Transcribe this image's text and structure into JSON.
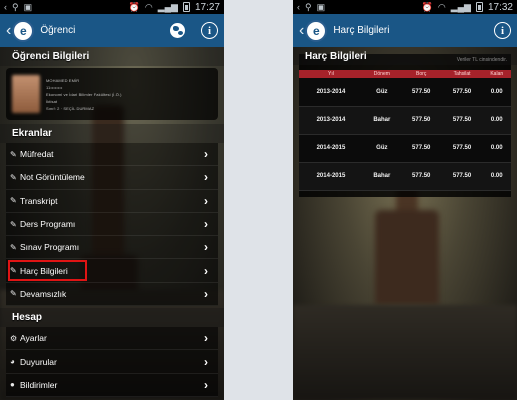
{
  "left_screen": {
    "status_bar": {
      "time": "17:27"
    },
    "action_bar": {
      "title": "Öğrenci",
      "logo_letter": "e"
    },
    "student_section": {
      "header": "Öğrenci Bilgileri",
      "profile_lines": [
        "MOHAMED EMİR",
        "11••••••••",
        "Ekonomi ve İdari Bilimler Fakültesi (İ.Ö.)",
        "İktisat",
        "Sınıf: 2 · SEÇİL DURMAZ"
      ]
    },
    "screens_section": {
      "header": "Ekranlar",
      "items": [
        {
          "label": "Müfredat",
          "icon": "pencil-icon"
        },
        {
          "label": "Not Görüntüleme",
          "icon": "pencil-icon"
        },
        {
          "label": "Transkript",
          "icon": "pencil-icon"
        },
        {
          "label": "Ders Programı",
          "icon": "pencil-icon"
        },
        {
          "label": "Sınav Programı",
          "icon": "pencil-icon"
        },
        {
          "label": "Harç Bilgileri",
          "icon": "pencil-icon",
          "highlighted": true
        },
        {
          "label": "Devamsızlık",
          "icon": "pencil-icon"
        }
      ]
    },
    "account_section": {
      "header": "Hesap",
      "items": [
        {
          "label": "Ayarlar",
          "icon": "gear-icon"
        },
        {
          "label": "Duyurular",
          "icon": "megaphone-icon"
        },
        {
          "label": "Bildirimler",
          "icon": "bell-icon"
        }
      ]
    }
  },
  "right_screen": {
    "status_bar": {
      "time": "17:32"
    },
    "action_bar": {
      "title": "Harç Bilgileri",
      "logo_letter": "e"
    },
    "panel_title": "Harç Bilgileri",
    "currency_note": "Veriler TL cinsindendir.",
    "table": {
      "columns": [
        "Yıl",
        "Dönem",
        "Borç",
        "Tahsilat",
        "Kalan"
      ],
      "rows": [
        [
          "2013-2014",
          "Güz",
          "577.50",
          "577.50",
          "0.00"
        ],
        [
          "2013-2014",
          "Bahar",
          "577.50",
          "577.50",
          "0.00"
        ],
        [
          "2014-2015",
          "Güz",
          "577.50",
          "577.50",
          "0.00"
        ],
        [
          "2014-2015",
          "Bahar",
          "577.50",
          "577.50",
          "0.00"
        ]
      ]
    }
  },
  "colors": {
    "action_bar": "#1a5686",
    "table_header": "#a6222a",
    "highlight": "#e01414"
  }
}
